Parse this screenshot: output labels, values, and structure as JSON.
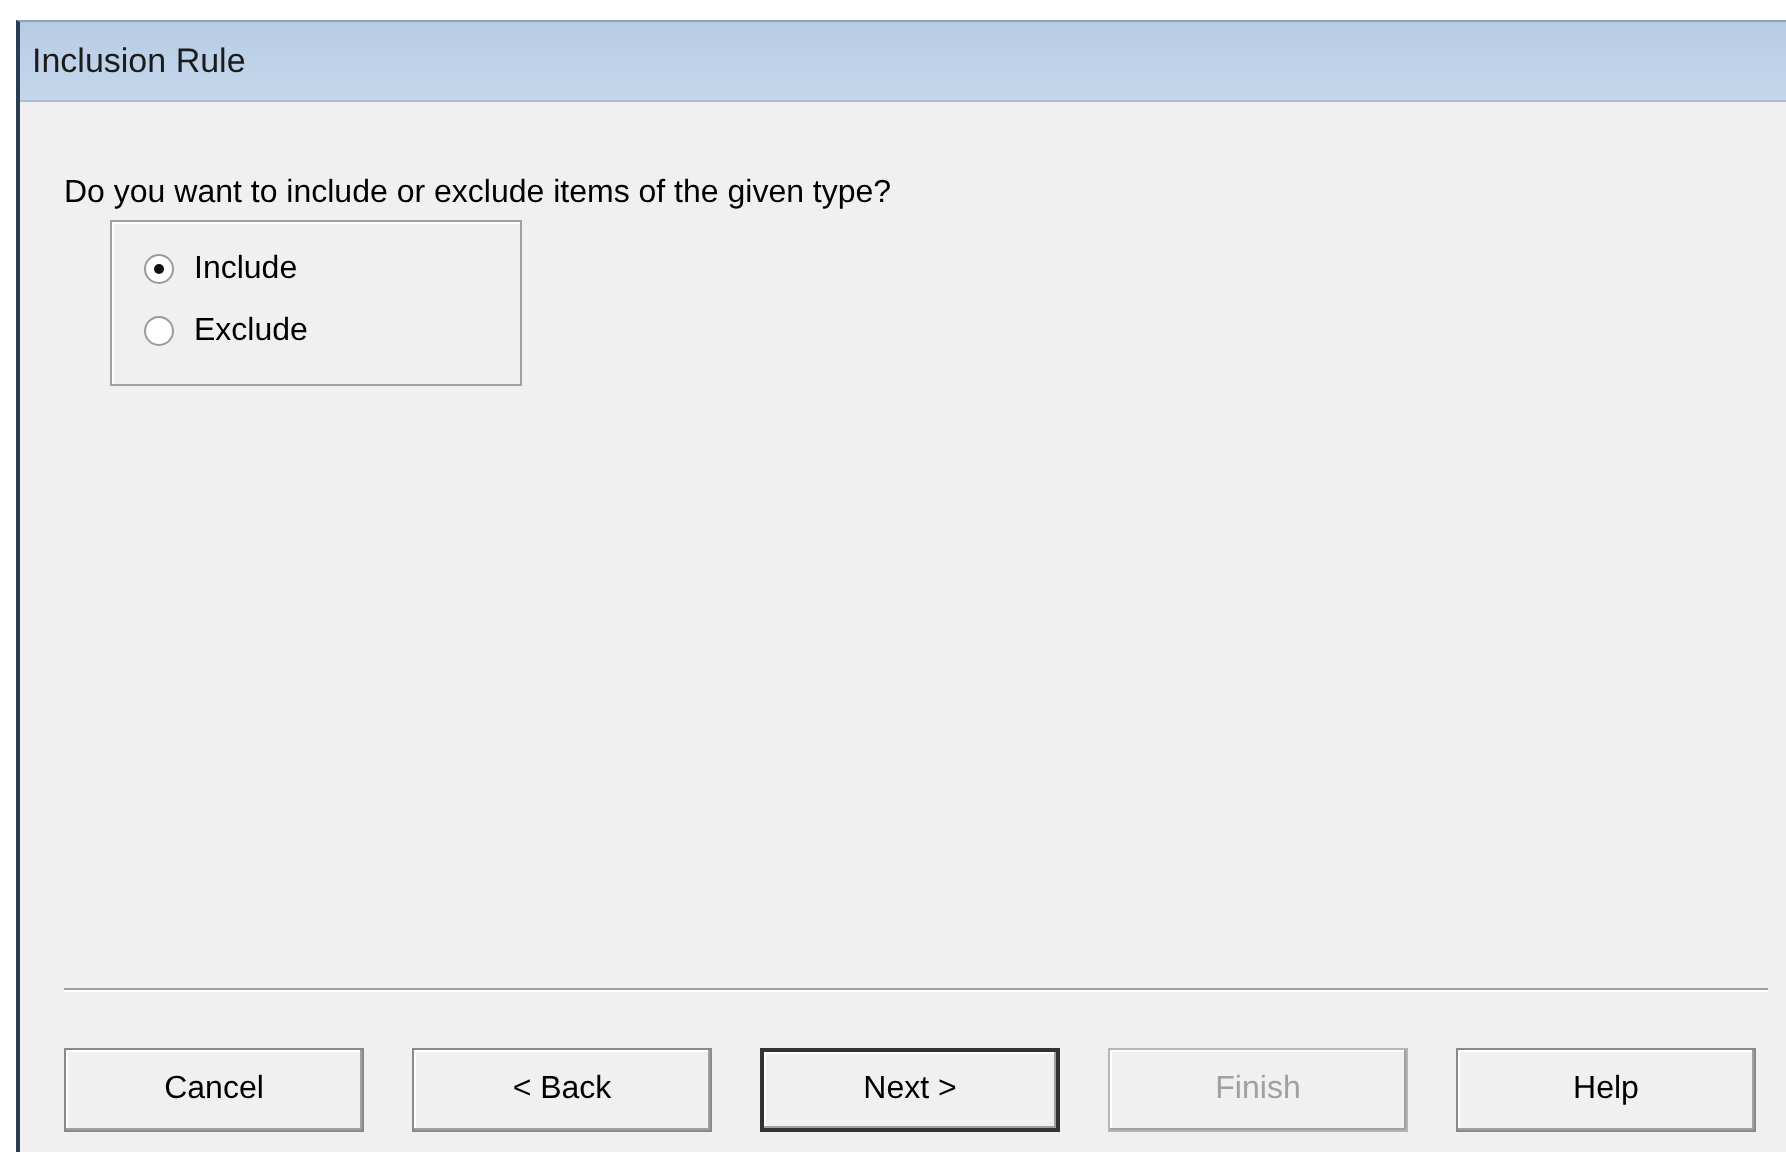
{
  "window": {
    "title": "Inclusion Rule"
  },
  "question": "Do you want to include or exclude items of the given type?",
  "options": [
    {
      "label": "Include",
      "selected": true
    },
    {
      "label": "Exclude",
      "selected": false
    }
  ],
  "buttons": [
    {
      "label": "Cancel",
      "disabled": false,
      "default": false
    },
    {
      "label": "< Back",
      "disabled": false,
      "default": false
    },
    {
      "label": "Next >",
      "disabled": false,
      "default": true
    },
    {
      "label": "Finish",
      "disabled": true,
      "default": false
    },
    {
      "label": "Help",
      "disabled": false,
      "default": false
    }
  ]
}
